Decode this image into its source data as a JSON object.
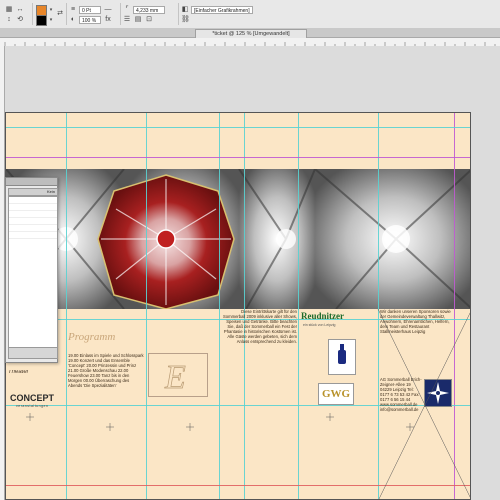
{
  "control_bar": {
    "stroke_weight": "0 Pt",
    "tint_percent": "100 %",
    "size_value": "4,233 mm",
    "style_menu": "[Einfacher Grafikrahmen]",
    "colors": {
      "fill": "#e8862a",
      "stroke": "#000000"
    }
  },
  "document_tab": {
    "label": "*ticket @ 125 % [Umgewandelt]"
  },
  "floating_panel": {
    "label": "Kein"
  },
  "document": {
    "programme_heading": "Programm",
    "theater_logo": "Theater",
    "concept_logo": "CONCEPT",
    "concept_sub": "veranstaltungen",
    "gwg_logo": "GWG",
    "reudnitzer_logo": "Reudnitzer",
    "reudnitzer_sub": "ein stück von Leipzig",
    "intro_text": "Diese Eintrittskarte gilt für den Sommerball 2009 inklusive aller Shows, Speisen und Getränke. Bitte beachten Sie, daß der Sommerball ein Fest der Phantasie in historischen Kostümen ist. Alle Gäste werden gebeten, sich dem Anlass entsprechend zu kleiden.",
    "program_text": "19.00 Einlass im Spiele und Schlosspark 19.00 Konzert und das Ensemble 'Concept' 20.00 Prinzessin und Prinz 21.00 Große Modenschau 22.00 Feuershow 23.00 Tanz bis in den Morgen 00.00 Überraschung des Abends 'Die Spezialitäten'",
    "sponsor_text": "Wir danken unseren Sponsoren sowie der Gemeindeverwaltung Thallwitz, Anwohnern, Ehrenamtlichen, Helfern, dem Team und Restaurant Stallmeisterhaus Leipzig",
    "address_text": "AG Sommerball Erich-Zeigner-Allee 19 04229 Leipzig Tel: 0177 6 73 53 42 Fax: 0177 6 56 15 44 www.sommerball.de info@sommerball.de"
  }
}
